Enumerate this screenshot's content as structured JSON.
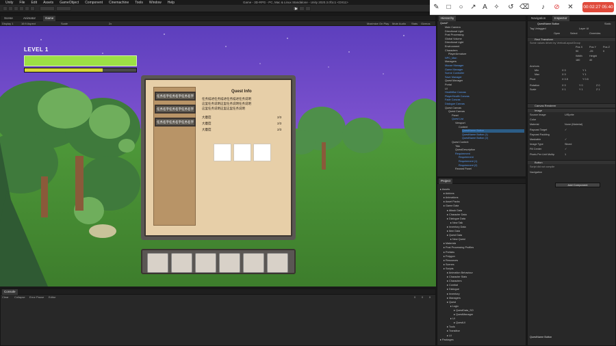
{
  "menu": {
    "app": "Unity",
    "items": [
      "File",
      "Edit",
      "Assets",
      "GameObject",
      "Component",
      "Cinemachine",
      "Tools",
      "Window",
      "Help"
    ],
    "window_title": "Game - 3D-RPG - PC, Mac & Linux Standalone - Unity 2020.3.0f1c1 <DX11>"
  },
  "recorder": {
    "timer": "00:02:27 05:40",
    "icons": [
      "pencil-icon",
      "square-icon",
      "circle-icon",
      "arrow-icon",
      "text-icon",
      "magic-icon",
      "undo-icon",
      "trash-icon",
      "speaker-icon",
      "mic-off-icon",
      "close-icon"
    ]
  },
  "scene_tabs": {
    "tabs": [
      "Scene",
      "Animator",
      "Game"
    ],
    "aspect": "16:9 Aspect",
    "scale": "Scale",
    "scale_value": "2x",
    "right": [
      "Maximize On Play",
      "Mute Audio",
      "Stats",
      "Gizmos"
    ],
    "display": "Display 1"
  },
  "game": {
    "level_label": "LEVEL 1",
    "hp_value": 1.0,
    "xp_value": 0.7,
    "quest_title": "Quest Info",
    "quest_buttons": [
      "任务名字任务名字任务名字",
      "任务名字任务名字任务名字",
      "任务名字任务名字任务名字"
    ],
    "quest_desc": [
      "任务描述任务描述任务描述任务说明",
      "这里任务说明这里任务说明任务说明",
      "这里任务说明这里这里任务说明"
    ],
    "requirements": [
      {
        "name": "大蘑菇",
        "count": "2/3"
      },
      {
        "name": "大蘑菇",
        "count": "2/3"
      },
      {
        "name": "大蘑菇",
        "count": "2/3"
      }
    ]
  },
  "console": {
    "tab": "Console",
    "toolbar": [
      "Clear",
      "Collapse",
      "Error Pause",
      "Editor"
    ],
    "counts": [
      "0",
      "0",
      "0"
    ]
  },
  "hierarchy": {
    "tab": "Hierarchy",
    "scene": "Quest*",
    "items": [
      {
        "t": "Main Camera",
        "d": 1
      },
      {
        "t": "Directional Light",
        "d": 1
      },
      {
        "t": "Post Processing",
        "d": 1
      },
      {
        "t": "Global Volume",
        "d": 1
      },
      {
        "t": "Directional Light",
        "d": 1
      },
      {
        "t": "Environment",
        "d": 1
      },
      {
        "t": "Characters",
        "d": 1
      },
      {
        "t": "PlayerArmature",
        "d": 2
      },
      {
        "t": "NPC_Man",
        "d": 1,
        "c": "blue"
      },
      {
        "t": "Managers",
        "d": 1
      },
      {
        "t": "Mouse Manager",
        "d": 1,
        "c": "blue"
      },
      {
        "t": "Game Manager",
        "d": 1,
        "c": "blue"
      },
      {
        "t": "Scene Controller",
        "d": 1,
        "c": "blue"
      },
      {
        "t": "Save Manager",
        "d": 1,
        "c": "blue"
      },
      {
        "t": "Quest Manager",
        "d": 1
      },
      {
        "t": "Portal",
        "d": 1
      },
      {
        "t": "UI",
        "d": 1
      },
      {
        "t": "HealthBar Canvas",
        "d": 1,
        "c": "blue"
      },
      {
        "t": "PlayerHealth Canvas",
        "d": 1,
        "c": "blue"
      },
      {
        "t": "Fade Canvas",
        "d": 1,
        "c": "blue"
      },
      {
        "t": "Dialogue Canvas",
        "d": 1,
        "c": "blue"
      },
      {
        "t": "Quest Canvas",
        "d": 1
      },
      {
        "t": "Quest Canvas",
        "d": 2
      },
      {
        "t": "Panel",
        "d": 3
      },
      {
        "t": "Quest List",
        "d": 3,
        "c": "blue"
      },
      {
        "t": "Viewport",
        "d": 4
      },
      {
        "t": "Content",
        "d": 5
      },
      {
        "t": "QuestName Button",
        "d": 6,
        "c": "blue",
        "s": true
      },
      {
        "t": "QuestName Button (1)",
        "d": 6,
        "c": "blue"
      },
      {
        "t": "QuestName Button (2)",
        "d": 6,
        "c": "blue"
      },
      {
        "t": "Quest Content",
        "d": 3
      },
      {
        "t": "Title",
        "d": 4
      },
      {
        "t": "QuestDescription",
        "d": 4
      },
      {
        "t": "Requirement",
        "d": 4,
        "c": "blue"
      },
      {
        "t": "Requirement",
        "d": 5,
        "c": "blue"
      },
      {
        "t": "Requirement (1)",
        "d": 5,
        "c": "blue"
      },
      {
        "t": "Requirement (2)",
        "d": 5,
        "c": "blue"
      },
      {
        "t": "Reward Panel",
        "d": 4
      }
    ]
  },
  "project": {
    "tab": "Project",
    "items": [
      {
        "t": "Assets",
        "d": 0
      },
      {
        "t": "Addons",
        "d": 1
      },
      {
        "t": "Animations",
        "d": 1
      },
      {
        "t": "Asset Packs",
        "d": 1
      },
      {
        "t": "Game Data",
        "d": 1
      },
      {
        "t": "Attack Data",
        "d": 2
      },
      {
        "t": "Character Data",
        "d": 2
      },
      {
        "t": "Dialogue Data",
        "d": 2
      },
      {
        "t": "New Talk",
        "d": 3
      },
      {
        "t": "Inventory Data",
        "d": 2
      },
      {
        "t": "Item Data",
        "d": 2
      },
      {
        "t": "Quest Data",
        "d": 2
      },
      {
        "t": "New Quest",
        "d": 3
      },
      {
        "t": "Materials",
        "d": 1
      },
      {
        "t": "Post Processing Profiles",
        "d": 1
      },
      {
        "t": "Prefabs",
        "d": 1
      },
      {
        "t": "Polygon",
        "d": 1
      },
      {
        "t": "Resources",
        "d": 1
      },
      {
        "t": "Scenes",
        "d": 1
      },
      {
        "t": "Scripts",
        "d": 1
      },
      {
        "t": "Animation Behaviour",
        "d": 2
      },
      {
        "t": "Character Stats",
        "d": 2
      },
      {
        "t": "Characters",
        "d": 2
      },
      {
        "t": "Combat",
        "d": 2
      },
      {
        "t": "Dialogue",
        "d": 2
      },
      {
        "t": "Inventory",
        "d": 2
      },
      {
        "t": "Managers",
        "d": 2
      },
      {
        "t": "Quest",
        "d": 2
      },
      {
        "t": "Logic",
        "d": 3
      },
      {
        "t": "QuestData_SO",
        "d": 4
      },
      {
        "t": "QuestManager",
        "d": 4
      },
      {
        "t": "UI",
        "d": 3
      },
      {
        "t": "QuestUI",
        "d": 4
      },
      {
        "t": "Tools",
        "d": 2
      },
      {
        "t": "Transition",
        "d": 2
      },
      {
        "t": "UI",
        "d": 2
      },
      {
        "t": "Packages",
        "d": 0
      }
    ]
  },
  "inspector": {
    "tabs": [
      "Navigation",
      "Inspector"
    ],
    "object": "QuestName Button",
    "static": "Static",
    "tag": "Untagged",
    "layer": "UI",
    "prefab": [
      "Open",
      "Select",
      "Overrides"
    ],
    "rect_header": "Rect Transform",
    "rect_note": "Some values driven by VerticalLayoutGroup",
    "rect_labels": [
      "Pos X",
      "Pos Y",
      "Pos Z"
    ],
    "rect_values": [
      "90",
      "-25",
      "0"
    ],
    "size_labels": [
      "Width",
      "Height"
    ],
    "size_values": [
      "180",
      "40"
    ],
    "anchors": "Anchors",
    "min": "Min",
    "max": "Max",
    "pivot": "Pivot",
    "rotation": "Rotation",
    "scale": "Scale",
    "anchor_vals": [
      "X 0",
      "Y 1",
      "X 0",
      "Y 1"
    ],
    "pivot_vals": [
      "X 0.5",
      "Y 0.5"
    ],
    "rot_vals": [
      "X 0",
      "Y 0",
      "Z 0"
    ],
    "scale_vals": [
      "X 1",
      "Y 1",
      "Z 1"
    ],
    "canvas_renderer": "Canvas Renderer",
    "image_header": "Image",
    "image_rows": [
      {
        "k": "Source Image",
        "v": "UISprite"
      },
      {
        "k": "Color",
        "v": ""
      },
      {
        "k": "Material",
        "v": "None (Material)"
      },
      {
        "k": "Raycast Target",
        "v": "✓"
      },
      {
        "k": "Raycast Padding",
        "v": ""
      },
      {
        "k": "Maskable",
        "v": "✓"
      },
      {
        "k": "Image Type",
        "v": "Sliced"
      },
      {
        "k": "Fill Center",
        "v": "✓"
      },
      {
        "k": "Pixels Per Unit Multip",
        "v": "1"
      }
    ],
    "button_header": "Button",
    "button_note": "Script did not compile",
    "navigation": "Navigation",
    "add_component": "Add Component",
    "footer": "QuestName Button"
  }
}
